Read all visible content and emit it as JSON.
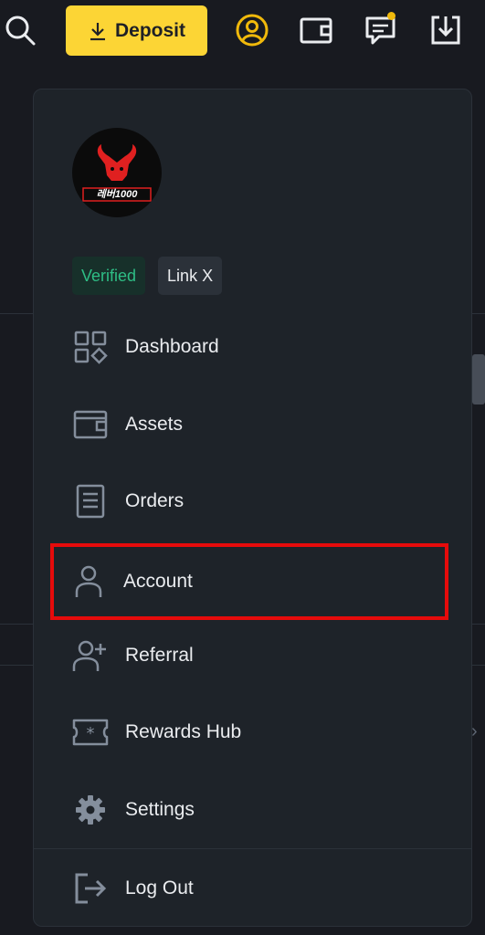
{
  "topbar": {
    "deposit_label": "Deposit",
    "icons": [
      "search-icon",
      "download-arrow-icon",
      "user-circle-icon",
      "wallet-icon",
      "message-icon",
      "download-box-icon"
    ],
    "accent_color": "#fcd535"
  },
  "profile": {
    "avatar_text": "레버1000",
    "verified_label": "Verified",
    "link_label": "Link X"
  },
  "menu": {
    "items": [
      {
        "label": "Dashboard",
        "icon": "dashboard-icon"
      },
      {
        "label": "Assets",
        "icon": "wallet-icon"
      },
      {
        "label": "Orders",
        "icon": "document-icon"
      },
      {
        "label": "Account",
        "icon": "user-icon"
      },
      {
        "label": "Referral",
        "icon": "add-user-icon"
      },
      {
        "label": "Rewards Hub",
        "icon": "ticket-icon"
      },
      {
        "label": "Settings",
        "icon": "gear-icon"
      },
      {
        "label": "Log Out",
        "icon": "logout-icon"
      }
    ]
  },
  "highlight_color": "#e60b0b"
}
